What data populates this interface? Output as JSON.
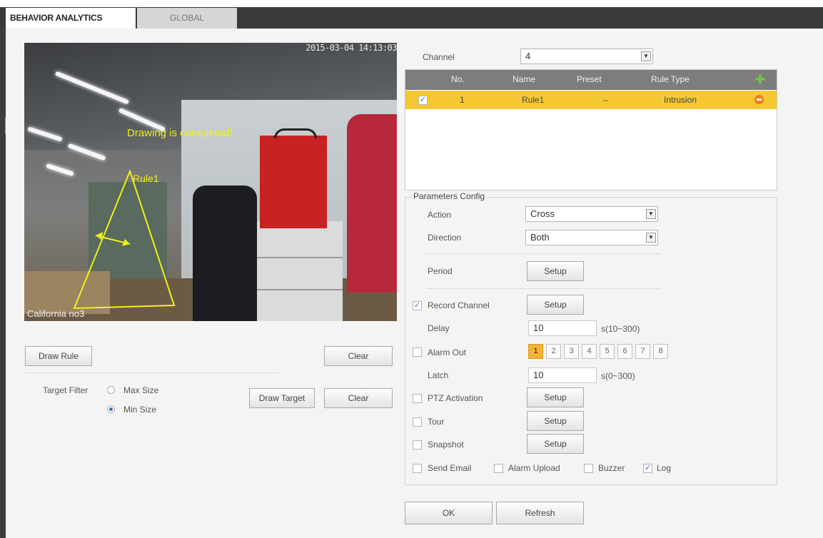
{
  "tabs": {
    "active": "BEHAVIOR ANALYTICS",
    "inactive": "GLOBAL"
  },
  "video": {
    "timestamp": "2015-03-04 14:13:03",
    "message": "Drawing is completed!",
    "rule_label": "Rule1",
    "camera_name": "California  no3"
  },
  "left": {
    "draw_rule": "Draw Rule",
    "clear": "Clear",
    "target_filter": "Target Filter",
    "max_size": "Max Size",
    "min_size": "Min Size",
    "draw_target": "Draw Target",
    "clear2": "Clear",
    "selected_size": "Min Size"
  },
  "channel": {
    "label": "Channel",
    "value": "4"
  },
  "rules_table": {
    "headers": {
      "no": "No.",
      "name": "Name",
      "preset": "Preset",
      "rule_type": "Rule Type"
    },
    "rows": [
      {
        "checked": true,
        "no": "1",
        "name": "Rule1",
        "preset": "--",
        "rule_type": "Intrusion"
      }
    ]
  },
  "params": {
    "title": "Parameters Config",
    "action_label": "Action",
    "action_value": "Cross",
    "direction_label": "Direction",
    "direction_value": "Both",
    "period_label": "Period",
    "period_btn": "Setup",
    "record_channel_label": "Record Channel",
    "record_channel_btn": "Setup",
    "record_channel_checked": true,
    "delay_label": "Delay",
    "delay_value": "10",
    "delay_range": "s(10~300)",
    "alarm_out_label": "Alarm Out",
    "alarm_out_channels": [
      "1",
      "2",
      "3",
      "4",
      "5",
      "6",
      "7",
      "8"
    ],
    "alarm_out_selected": "1",
    "latch_label": "Latch",
    "latch_value": "10",
    "latch_range": "s(0~300)",
    "ptz_label": "PTZ Activation",
    "ptz_btn": "Setup",
    "tour_label": "Tour",
    "tour_btn": "Setup",
    "snapshot_label": "Snapshot",
    "snapshot_btn": "Setup",
    "send_email_label": "Send Email",
    "alarm_upload_label": "Alarm Upload",
    "buzzer_label": "Buzzer",
    "log_label": "Log",
    "log_checked": true
  },
  "footer": {
    "ok": "OK",
    "refresh": "Refresh"
  },
  "colors": {
    "header_bar": "#3a3a3a",
    "selected_row": "#f5c833",
    "overlay_text": "#f0f01a",
    "accent_orange": "#f4b534"
  }
}
